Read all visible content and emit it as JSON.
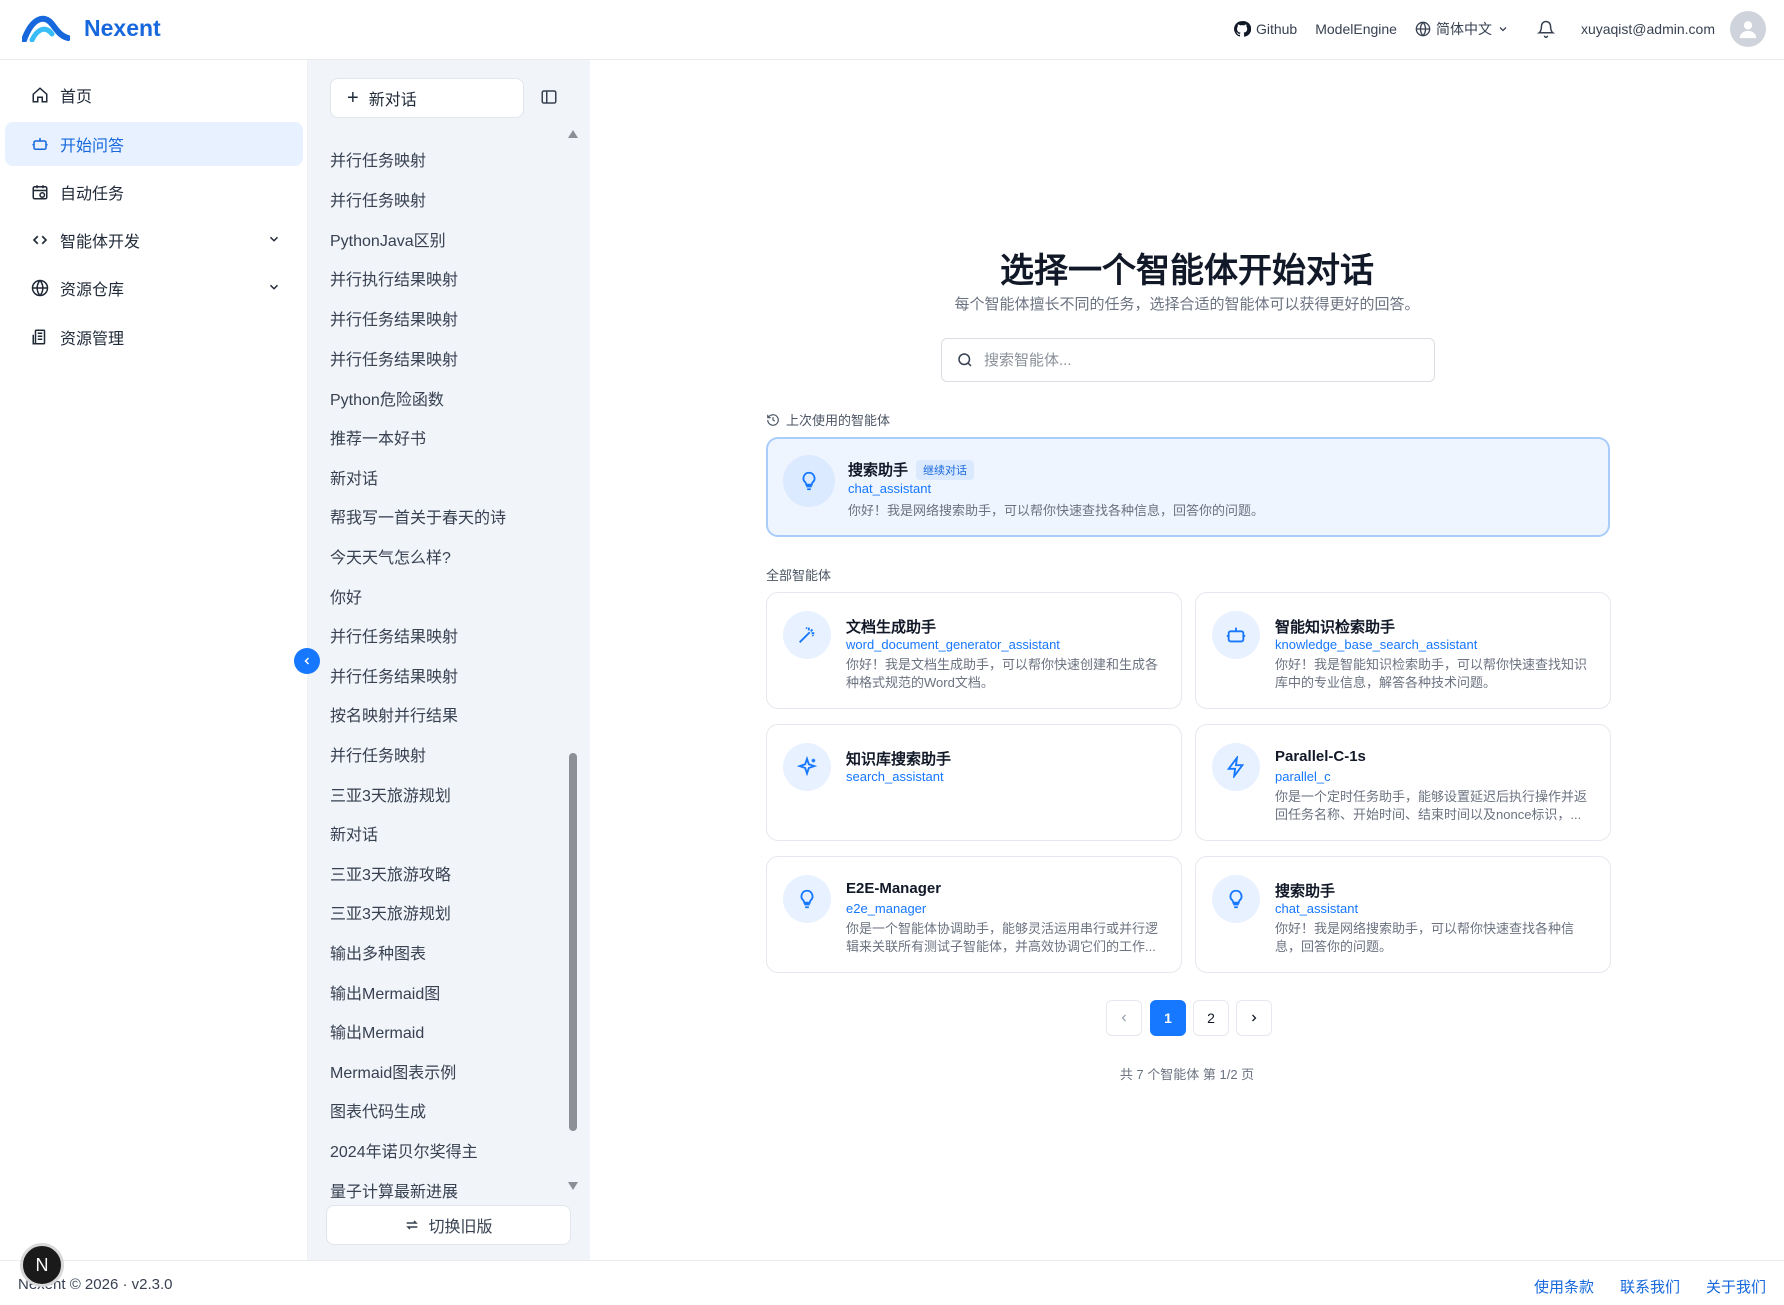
{
  "brand": {
    "name": "Nexent"
  },
  "header": {
    "github": "Github",
    "model_engine": "ModelEngine",
    "language": "简体中文",
    "user_email": "xuyaqist@admin.com"
  },
  "sidebar": {
    "items": [
      {
        "label": "首页",
        "icon": "home-icon"
      },
      {
        "label": "开始问答",
        "icon": "robot-icon",
        "active": true
      },
      {
        "label": "自动任务",
        "icon": "calendar-clock-icon"
      },
      {
        "label": "智能体开发",
        "icon": "code-icon",
        "expandable": true
      },
      {
        "label": "资源仓库",
        "icon": "globe-icon",
        "expandable": true
      },
      {
        "label": "资源管理",
        "icon": "database-icon"
      }
    ]
  },
  "history": {
    "new_chat": "新对话",
    "switch_old": "切换旧版",
    "items": [
      "并行任务映射",
      "并行任务映射",
      "PythonJava区别",
      "并行执行结果映射",
      "并行任务结果映射",
      "并行任务结果映射",
      "Python危险函数",
      "推荐一本好书",
      "新对话",
      "帮我写一首关于春天的诗",
      "今天天气怎么样?",
      "你好",
      "并行任务结果映射",
      "并行任务结果映射",
      "按名映射并行结果",
      "并行任务映射",
      "三亚3天旅游规划",
      "新对话",
      "三亚3天旅游攻略",
      "三亚3天旅游规划",
      "输出多种图表",
      "输出Mermaid图",
      "输出Mermaid",
      "Mermaid图表示例",
      "图表代码生成",
      "2024年诺贝尔奖得主",
      "量子计算最新进展"
    ]
  },
  "main": {
    "title": "选择一个智能体开始对话",
    "subtitle": "每个智能体擅长不同的任务，选择合适的智能体可以获得更好的回答。",
    "search_placeholder": "搜索智能体...",
    "recent_label": "上次使用的智能体",
    "all_label": "全部智能体",
    "recent_agent": {
      "name": "搜索助手",
      "badge": "继续对话",
      "id": "chat_assistant",
      "desc": "你好！我是网络搜索助手，可以帮你快速查找各种信息，回答你的问题。",
      "icon": "lightbulb-icon"
    },
    "agents": [
      {
        "name": "文档生成助手",
        "id": "word_document_generator_assistant",
        "desc": "你好！我是文档生成助手，可以帮你快速创建和生成各种格式规范的Word文档。",
        "icon": "magic-wand-icon"
      },
      {
        "name": "智能知识检索助手",
        "id": "knowledge_base_search_assistant",
        "desc": "你好！我是智能知识检索助手，可以帮你快速查找知识库中的专业信息，解答各种技术问题。",
        "icon": "robot-icon"
      },
      {
        "name": "知识库搜索助手",
        "id": "search_assistant",
        "desc": "",
        "icon": "sparkles-icon"
      },
      {
        "name": "Parallel-C-1s",
        "id": "parallel_c",
        "desc": "你是一个定时任务助手，能够设置延迟后执行操作并返回任务名称、开始时间、结束时间以及nonce标识，...",
        "icon": "lightning-icon"
      },
      {
        "name": "E2E-Manager",
        "id": "e2e_manager",
        "desc": "你是一个智能体协调助手，能够灵活运用串行或并行逻辑来关联所有测试子智能体，并高效协调它们的工作...",
        "icon": "lightbulb-icon"
      },
      {
        "name": "搜索助手",
        "id": "chat_assistant",
        "desc": "你好！我是网络搜索助手，可以帮你快速查找各种信息，回答你的问题。",
        "icon": "lightbulb-icon"
      }
    ],
    "pagination": {
      "pages": [
        "1",
        "2"
      ],
      "current": "1",
      "info": "共 7 个智能体 第 1/2 页"
    }
  },
  "footer": {
    "copyright": "Nexent © 2026 · v2.3.0",
    "links": [
      "使用条款",
      "联系我们",
      "关于我们"
    ]
  },
  "floating_badge": "N",
  "colors": {
    "accent": "#1677ff",
    "active_bg": "#e8f1ff",
    "brand": "#1668dc"
  }
}
